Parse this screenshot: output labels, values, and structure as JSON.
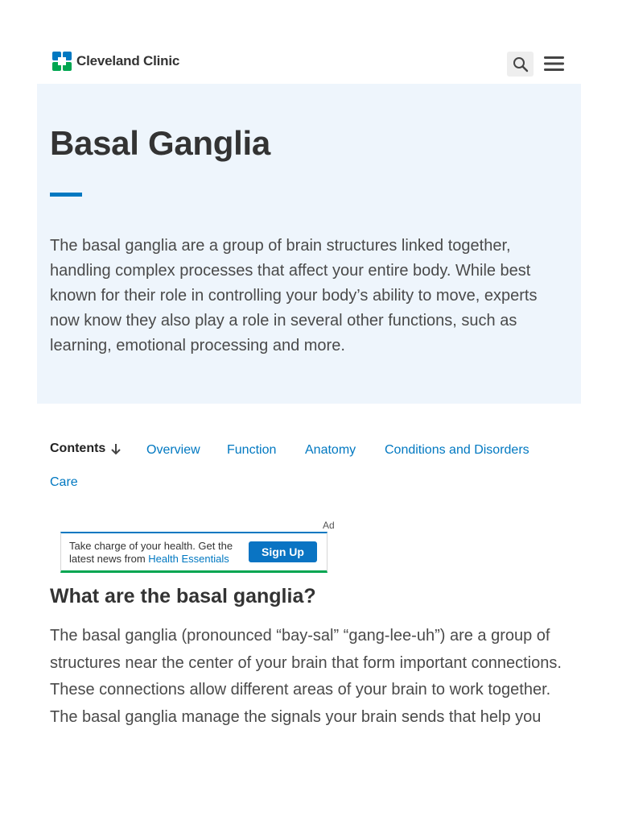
{
  "header": {
    "logo_text": "Cleveland Clinic",
    "logo_icon": "cleveland-clinic-cross-logo",
    "search_icon": "magnifier",
    "menu_icon": "hamburger"
  },
  "hero": {
    "title": "Basal Ganglia",
    "intro": "The basal ganglia are a group of brain structures linked together, handling complex processes that affect your entire body. While best known for their role in controlling your body’s ability to move, experts now know they also play a role in several other functions, such as learning, emotional processing and more."
  },
  "contents": {
    "label": "Contents",
    "arrow_icon": "arrow-down",
    "links": [
      "Overview",
      "Function",
      "Anatomy",
      "Conditions and Disorders",
      "Care"
    ]
  },
  "ad": {
    "label": "Ad",
    "text_before": "Take charge of your health. Get the latest news from ",
    "link_text": "Health Essentials",
    "button_label": "Sign Up"
  },
  "article": {
    "heading": "What are the basal ganglia?",
    "paragraph": "The basal ganglia (pronounced “bay-sal” “gang-lee-uh”) are a group of structures near the center of your brain that form important connections. These connections allow different areas of your brain to work together. The basal ganglia manage the signals your brain sends that help you"
  },
  "colors": {
    "brand_blue": "#0078c1",
    "brand_green": "#00a651",
    "hero_background": "#eef5fc"
  }
}
